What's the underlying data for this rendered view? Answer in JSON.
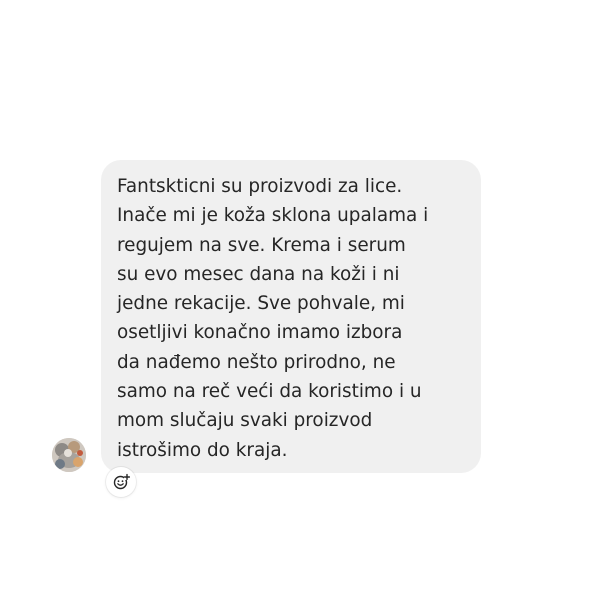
{
  "message": {
    "lines": [
      "Fantskticni su proizvodi za lice.",
      "Inače mi je koža sklona upalama i",
      "regujem na sve. Krema i serum",
      "su evo mesec dana na koži i ni",
      "jedne rekacije. Sve pohvale, mi",
      "osetljivi konačno imamo izbora",
      "da nađemo nešto prirodno, ne",
      "samo na reč veći da koristimo i u",
      "mom slučaju svaki proizvod",
      "istrošimo do kraja."
    ]
  },
  "icons": {
    "avatar": "sender-avatar",
    "reaction": "add-reaction-icon"
  },
  "colors": {
    "bubble_background": "#f0f0f0",
    "text": "#262626",
    "page_background": "#ffffff"
  }
}
